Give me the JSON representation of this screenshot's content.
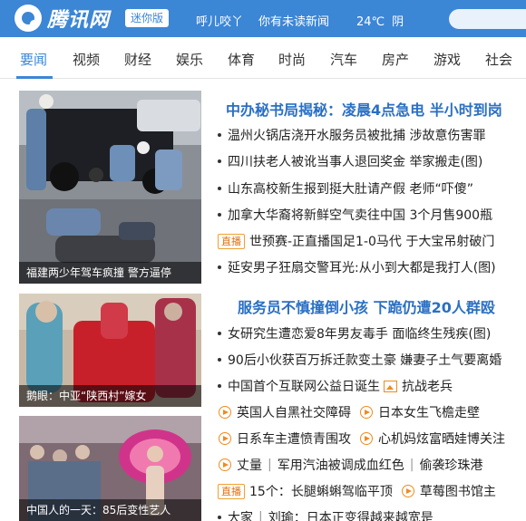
{
  "header": {
    "logo_text": "腾讯网",
    "mini_label": "迷你版",
    "greeting": "呼儿咬丫",
    "news_alert": "你有未读新闻",
    "weather": {
      "temp": "24℃",
      "condition": "阴"
    }
  },
  "nav": {
    "items": [
      "要闻",
      "视频",
      "财经",
      "娱乐",
      "体育",
      "时尚",
      "汽车",
      "房产",
      "游戏",
      "社会"
    ],
    "active": "要闻"
  },
  "section1": {
    "image_caption": "福建两少年驾车疯撞 警方逼停",
    "headline": "中办秘书局揭秘：凌晨4点急电 半小时到岗",
    "items": [
      {
        "text": "温州火锅店浇开水服务员被批捕 涉故意伤害罪"
      },
      {
        "text": "四川扶老人被讹当事人退回奖金 举家搬走(图)"
      },
      {
        "text": "山东高校新生报到挺大肚请产假 老师“吓傻”"
      },
      {
        "text": "加拿大华裔将新鲜空气卖往中国 3个月售900瓶"
      },
      {
        "tag": "直播",
        "text": "世预赛-正直播国足1-0马代 于大宝吊射破门"
      },
      {
        "text": "延安男子狂扇交警耳光:从小到大都是我打人(图)"
      }
    ]
  },
  "section2": {
    "image_caption": "鹅眼：中亚“陕西村”嫁女",
    "image2_caption": "中国人的一天：85后变性艺人",
    "headline": "服务员不慎撞倒小孩 下跪仍遭20人群殴",
    "items": [
      {
        "text": "女研究生遭恋爱8年男友毒手 面临终生残疾(图)"
      },
      {
        "text": "90后小伙获百万拆迁款变土豪 嫌妻子土气要离婚"
      },
      {
        "text": "中国首个互联网公益日诞生",
        "icon2": "image-icon",
        "text2": "抗战老兵"
      },
      {
        "icon": "play-icon",
        "text": "英国人自黑社交障碍",
        "icon2": "play-icon",
        "text2": "日本女生飞檐走壁"
      },
      {
        "icon": "play-icon",
        "text": "日系车主遭愤青围攻",
        "icon2": "play-icon",
        "text2": "心机妈炫富晒娃博关注"
      },
      {
        "icon": "play-icon",
        "text": "丈量",
        "sep": "|",
        "text_b": "军用汽油被调成血红色",
        "sep2": "|",
        "text2": "偷袭珍珠港"
      },
      {
        "tag": "直播",
        "text": "15个：长腿蝌蝌驾临平顶",
        "icon2": "play-icon",
        "text2": "草莓图书馆主"
      },
      {
        "text": "大家",
        "sep": "|",
        "text_b": "刘瑜：日本正变得越来越宽是"
      }
    ]
  },
  "colors": {
    "brand_blue": "#3c86d6",
    "headline_blue": "#2a6fc4",
    "tag_orange": "#e07010"
  }
}
